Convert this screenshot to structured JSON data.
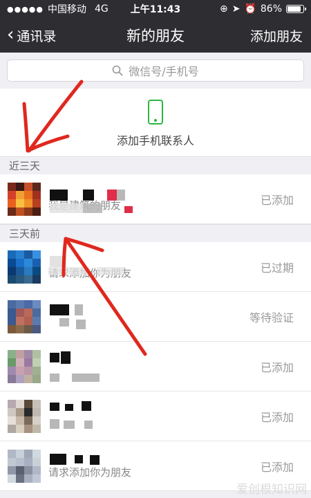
{
  "status_bar": {
    "carrier": "中国移动",
    "network": "4G",
    "time": "上午11:43",
    "battery": "86%",
    "battery_level": 0.86
  },
  "nav": {
    "back_label": "通讯录",
    "title": "新的朋友",
    "action_label": "添加朋友"
  },
  "search": {
    "placeholder": "微信号/手机号"
  },
  "add_phone_contacts": {
    "label": "添加手机联系人",
    "icon": "phone-icon",
    "accent": "#2bb741"
  },
  "sections": [
    {
      "header": "近三天",
      "items": [
        {
          "subtitle": "我是建筑的朋友",
          "status": "已添加"
        }
      ]
    },
    {
      "header": "三天前",
      "items": [
        {
          "subtitle": "请求添加你为朋友",
          "status": "已过期"
        },
        {
          "subtitle": "",
          "status": "等待验证"
        },
        {
          "subtitle": "",
          "status": "已添加"
        },
        {
          "subtitle": "",
          "status": "已添加"
        },
        {
          "subtitle": "请求添加你为朋友",
          "status": "已添加"
        }
      ]
    }
  ],
  "watermark": "爱创根知识网",
  "colors": {
    "header_bg": "#2d2d32",
    "annotation_red": "#e0281e"
  }
}
